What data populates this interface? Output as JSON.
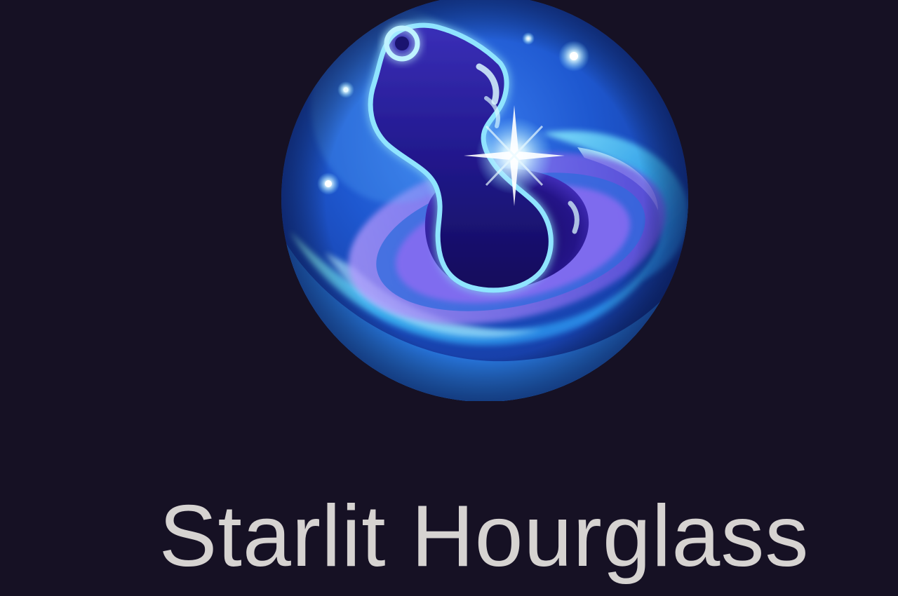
{
  "item": {
    "name": "Starlit Hourglass",
    "icon": "starlit-hourglass-icon"
  },
  "colors": {
    "background": "#161124",
    "label": "#d6d3d1",
    "orb_primary": "#2a63d8",
    "orb_glow": "#6fd6ff",
    "vortex": "#9a7cf0"
  }
}
